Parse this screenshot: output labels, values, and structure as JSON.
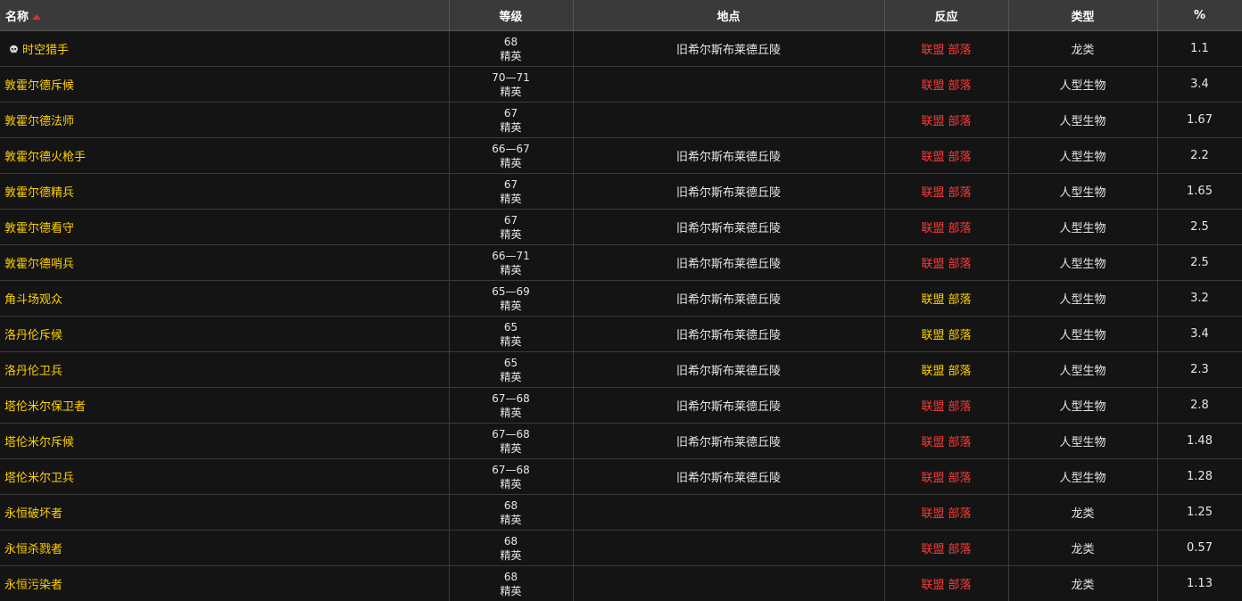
{
  "header": {
    "name": "名称",
    "level": "等级",
    "location": "地点",
    "reaction": "反应",
    "type": "类型",
    "percent": "%"
  },
  "colors": {
    "hostile": "#ff3a3a",
    "neutral": "#ffd100",
    "link": "#ffd100"
  },
  "rows": [
    {
      "name": "时空猎手",
      "icon": "skull-icon",
      "level": "68",
      "classification": "精英",
      "location": "旧希尔斯布莱德丘陵",
      "alliance": "联盟",
      "horde": "部落",
      "reaction": "hostile",
      "type": "龙类",
      "percent": "1.1"
    },
    {
      "name": "敦霍尔德斥候",
      "level": "70—71",
      "classification": "精英",
      "location": "",
      "alliance": "联盟",
      "horde": "部落",
      "reaction": "hostile",
      "type": "人型生物",
      "percent": "3.4"
    },
    {
      "name": "敦霍尔德法师",
      "level": "67",
      "classification": "精英",
      "location": "",
      "alliance": "联盟",
      "horde": "部落",
      "reaction": "hostile",
      "type": "人型生物",
      "percent": "1.67"
    },
    {
      "name": "敦霍尔德火枪手",
      "level": "66—67",
      "classification": "精英",
      "location": "旧希尔斯布莱德丘陵",
      "alliance": "联盟",
      "horde": "部落",
      "reaction": "hostile",
      "type": "人型生物",
      "percent": "2.2"
    },
    {
      "name": "敦霍尔德精兵",
      "level": "67",
      "classification": "精英",
      "location": "旧希尔斯布莱德丘陵",
      "alliance": "联盟",
      "horde": "部落",
      "reaction": "hostile",
      "type": "人型生物",
      "percent": "1.65"
    },
    {
      "name": "敦霍尔德看守",
      "level": "67",
      "classification": "精英",
      "location": "旧希尔斯布莱德丘陵",
      "alliance": "联盟",
      "horde": "部落",
      "reaction": "hostile",
      "type": "人型生物",
      "percent": "2.5"
    },
    {
      "name": "敦霍尔德哨兵",
      "level": "66—71",
      "classification": "精英",
      "location": "旧希尔斯布莱德丘陵",
      "alliance": "联盟",
      "horde": "部落",
      "reaction": "hostile",
      "type": "人型生物",
      "percent": "2.5"
    },
    {
      "name": "角斗场观众",
      "level": "65—69",
      "classification": "精英",
      "location": "旧希尔斯布莱德丘陵",
      "alliance": "联盟",
      "horde": "部落",
      "reaction": "neutral",
      "type": "人型生物",
      "percent": "3.2"
    },
    {
      "name": "洛丹伦斥候",
      "level": "65",
      "classification": "精英",
      "location": "旧希尔斯布莱德丘陵",
      "alliance": "联盟",
      "horde": "部落",
      "reaction": "neutral",
      "type": "人型生物",
      "percent": "3.4"
    },
    {
      "name": "洛丹伦卫兵",
      "level": "65",
      "classification": "精英",
      "location": "旧希尔斯布莱德丘陵",
      "alliance": "联盟",
      "horde": "部落",
      "reaction": "neutral",
      "type": "人型生物",
      "percent": "2.3"
    },
    {
      "name": "塔伦米尔保卫者",
      "level": "67—68",
      "classification": "精英",
      "location": "旧希尔斯布莱德丘陵",
      "alliance": "联盟",
      "horde": "部落",
      "reaction": "hostile",
      "type": "人型生物",
      "percent": "2.8"
    },
    {
      "name": "塔伦米尔斥候",
      "level": "67—68",
      "classification": "精英",
      "location": "旧希尔斯布莱德丘陵",
      "alliance": "联盟",
      "horde": "部落",
      "reaction": "hostile",
      "type": "人型生物",
      "percent": "1.48"
    },
    {
      "name": "塔伦米尔卫兵",
      "level": "67—68",
      "classification": "精英",
      "location": "旧希尔斯布莱德丘陵",
      "alliance": "联盟",
      "horde": "部落",
      "reaction": "hostile",
      "type": "人型生物",
      "percent": "1.28"
    },
    {
      "name": "永恒破坏者",
      "level": "68",
      "classification": "精英",
      "location": "",
      "alliance": "联盟",
      "horde": "部落",
      "reaction": "hostile",
      "type": "龙类",
      "percent": "1.25"
    },
    {
      "name": "永恒杀戮者",
      "level": "68",
      "classification": "精英",
      "location": "",
      "alliance": "联盟",
      "horde": "部落",
      "reaction": "hostile",
      "type": "龙类",
      "percent": "0.57"
    },
    {
      "name": "永恒污染者",
      "level": "68",
      "classification": "精英",
      "location": "",
      "alliance": "联盟",
      "horde": "部落",
      "reaction": "hostile",
      "type": "龙类",
      "percent": "1.13"
    }
  ]
}
